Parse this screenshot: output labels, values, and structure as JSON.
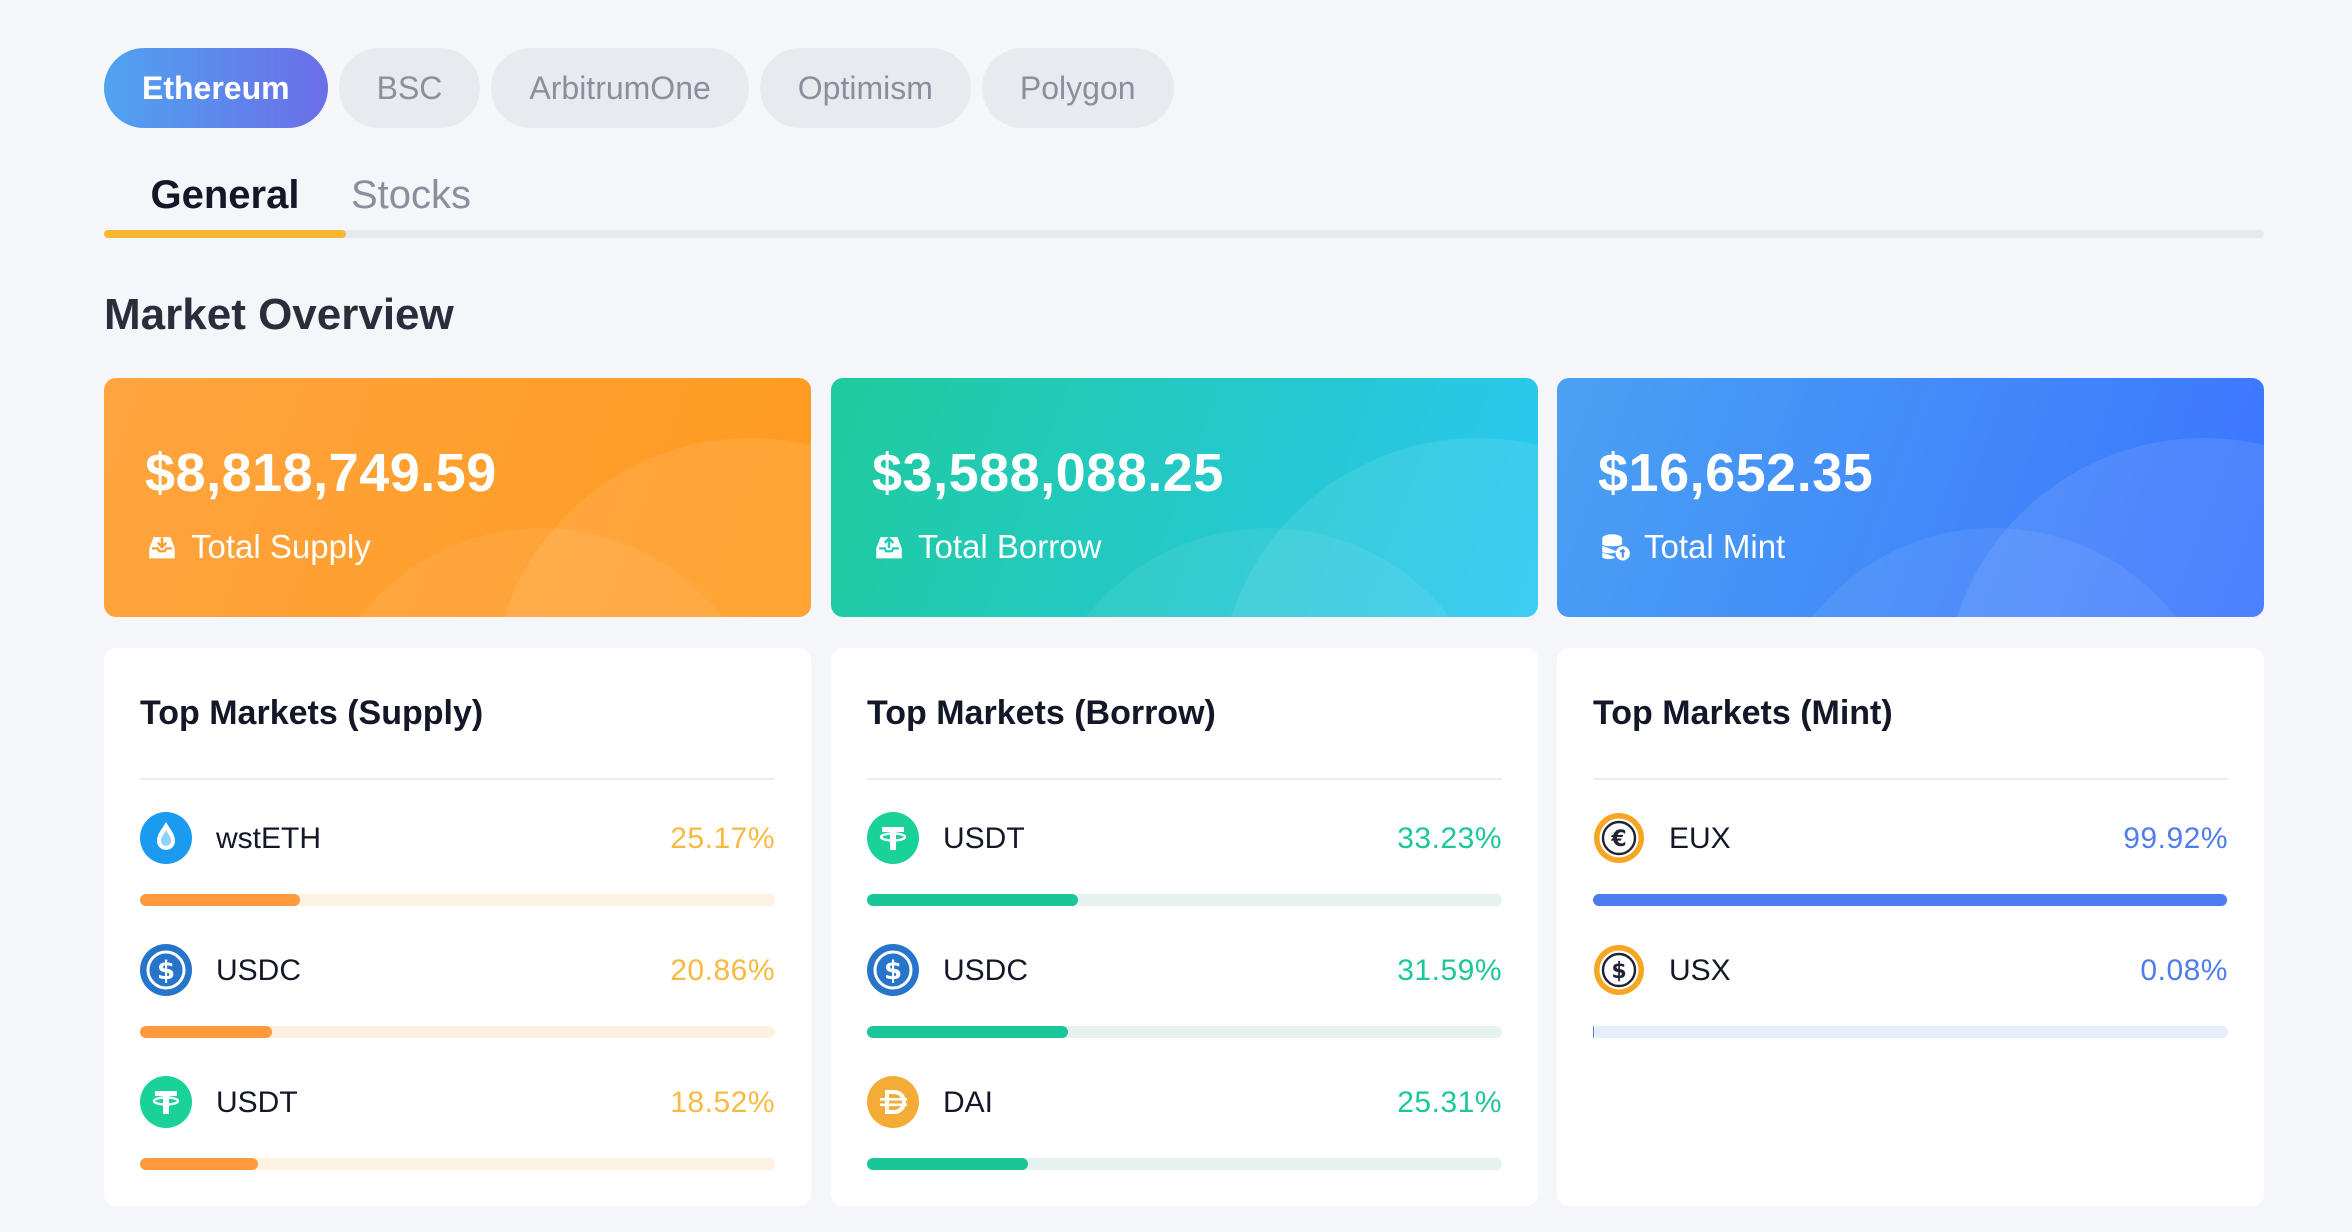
{
  "networks": [
    {
      "label": "Ethereum",
      "active": true
    },
    {
      "label": "BSC",
      "active": false
    },
    {
      "label": "ArbitrumOne",
      "active": false
    },
    {
      "label": "Optimism",
      "active": false
    },
    {
      "label": "Polygon",
      "active": false
    }
  ],
  "tabs": [
    {
      "label": "General",
      "active": true
    },
    {
      "label": "Stocks",
      "active": false
    }
  ],
  "section_title": "Market Overview",
  "stats": {
    "supply": {
      "value": "$8,818,749.59",
      "label": "Total Supply",
      "icon": "tray-download-icon"
    },
    "borrow": {
      "value": "$3,588,088.25",
      "label": "Total Borrow",
      "icon": "tray-upload-icon"
    },
    "mint": {
      "value": "$16,652.35",
      "label": "Total Mint",
      "icon": "coins-stack-icon"
    }
  },
  "markets": {
    "supply": {
      "title": "Top Markets (Supply)",
      "items": [
        {
          "name": "wstETH",
          "percent": "25.17%",
          "share": 0.2517,
          "icon": "wsteth-icon"
        },
        {
          "name": "USDC",
          "percent": "20.86%",
          "share": 0.2086,
          "icon": "usdc-icon"
        },
        {
          "name": "USDT",
          "percent": "18.52%",
          "share": 0.1852,
          "icon": "usdt-icon"
        }
      ]
    },
    "borrow": {
      "title": "Top Markets (Borrow)",
      "items": [
        {
          "name": "USDT",
          "percent": "33.23%",
          "share": 0.3323,
          "icon": "usdt-icon"
        },
        {
          "name": "USDC",
          "percent": "31.59%",
          "share": 0.3159,
          "icon": "usdc-icon"
        },
        {
          "name": "DAI",
          "percent": "25.31%",
          "share": 0.2531,
          "icon": "dai-icon"
        }
      ]
    },
    "mint": {
      "title": "Top Markets (Mint)",
      "items": [
        {
          "name": "EUX",
          "percent": "99.92%",
          "share": 0.9992,
          "icon": "eux-icon"
        },
        {
          "name": "USX",
          "percent": "0.08%",
          "share": 0.0008,
          "icon": "usx-icon"
        }
      ]
    }
  },
  "colors": {
    "accent": "#f7b731",
    "supply": "#ff9a3c",
    "borrow": "#1ac598",
    "mint": "#4c7bf0"
  }
}
